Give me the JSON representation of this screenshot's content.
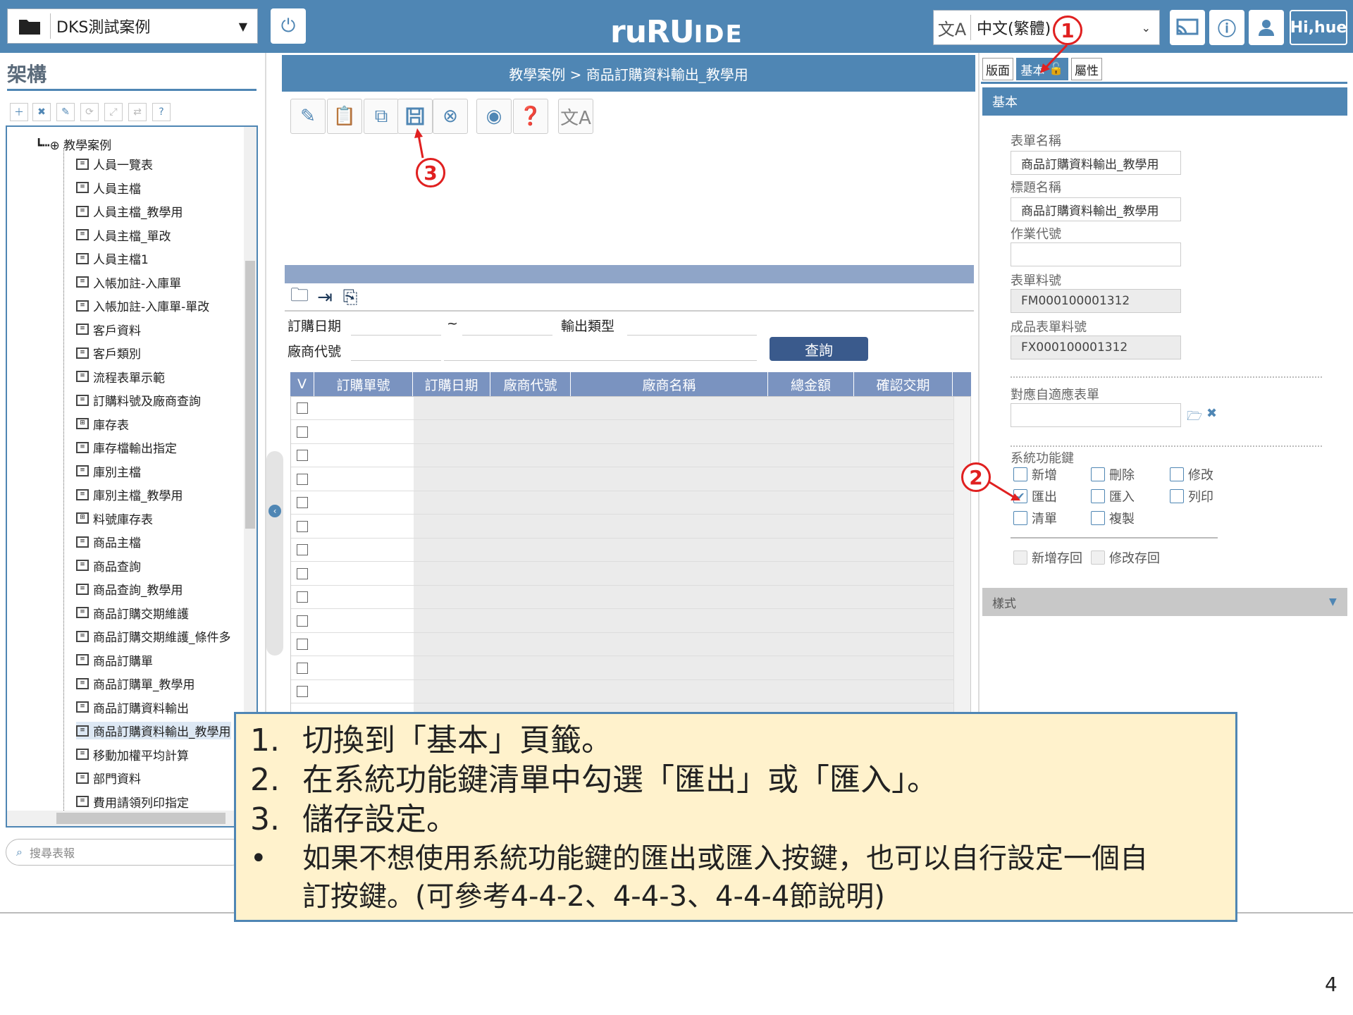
{
  "header": {
    "project": "DKS測試案例",
    "logo": "ruRUIDE",
    "logo_main": "ruRU",
    "logo_suffix": "IDE",
    "language": "中文(繁體)",
    "greeting": "Hi,hue"
  },
  "left": {
    "title": "架構",
    "search_placeholder": "搜尋表報",
    "tree_root": "教學案例",
    "tree_items": [
      "人員一覽表",
      "人員主檔",
      "人員主檔_教學用",
      "人員主檔_單改",
      "人員主檔1",
      "入帳加註-入庫單",
      "入帳加註-入庫單-單改",
      "客戶資料",
      "客戶類別",
      "流程表單示範",
      "訂購料號及廠商查詢",
      "庫存表",
      "庫存檔輸出指定",
      "庫別主檔",
      "庫別主檔_教學用",
      "料號庫存表",
      "商品主檔",
      "商品查詢",
      "商品查詢_教學用",
      "商品訂購交期維護",
      "商品訂購交期維護_條件多",
      "商品訂購單",
      "商品訂購單_教學用",
      "商品訂購資料輸出",
      "商品訂購資料輸出_教學用",
      "移動加權平均計算",
      "部門資料",
      "費用請領列印指定"
    ]
  },
  "center": {
    "breadcrumb": "教學案例  >  商品訂購資料輸出_教學用",
    "query": {
      "order_date_label": "訂購日期",
      "tilde": "~",
      "output_type_label": "輸出類型",
      "vendor_code_label": "廠商代號",
      "query_button": "查詢"
    },
    "grid_columns": [
      "V",
      "訂購單號",
      "訂購日期",
      "廠商代號",
      "廠商名稱",
      "總金額",
      "確認交期"
    ]
  },
  "right": {
    "tabs": [
      "版面",
      "基本",
      "屬性"
    ],
    "section": "基本",
    "form_name_label": "表單名稱",
    "form_name_value": "商品訂購資料輸出_教學用",
    "title_name_label": "標題名稱",
    "title_name_value": "商品訂購資料輸出_教學用",
    "job_code_label": "作業代號",
    "job_code_value": "",
    "form_part_label": "表單料號",
    "form_part_value": "FM000100001312",
    "product_form_label": "成品表單料號",
    "product_form_value": "FX000100001312",
    "adaptive_label": "對應自適應表單",
    "sys_keys_label": "系統功能鍵",
    "sys_keys": [
      {
        "label": "新增",
        "checked": false
      },
      {
        "label": "刪除",
        "checked": false
      },
      {
        "label": "修改",
        "checked": false
      },
      {
        "label": "匯出",
        "checked": true
      },
      {
        "label": "匯入",
        "checked": false
      },
      {
        "label": "列印",
        "checked": false
      },
      {
        "label": "清單",
        "checked": false
      },
      {
        "label": "複製",
        "checked": false
      }
    ],
    "save_new_label": "新增存回",
    "save_edit_label": "修改存回",
    "style_label": "樣式"
  },
  "callouts": [
    "1",
    "2",
    "3"
  ],
  "notes": {
    "step1_num": "1.",
    "step1": "切換到「基本」頁籤。",
    "step2_num": "2.",
    "step2": "在系統功能鍵清單中勾選「匯出」或「匯入」。",
    "step3_num": "3.",
    "step3": "儲存設定。",
    "bullet": "•",
    "tip_line1": "如果不想使用系統功能鍵的匯出或匯入按鍵，也可以自行設定一個自",
    "tip_line2": "訂按鍵。(可參考4-4-2、4-4-3、4-4-4節說明)"
  },
  "page_number": "4"
}
